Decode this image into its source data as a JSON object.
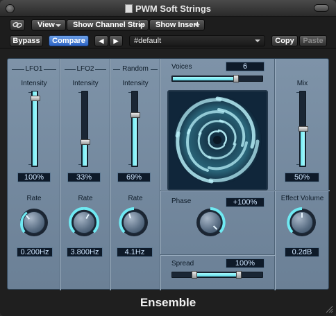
{
  "window": {
    "title": "PWM Soft Strings"
  },
  "toolbar": {
    "view_label": "View",
    "channel_strip_label": "Show Channel Strip",
    "insert_label": "Show Insert",
    "bypass_label": "Bypass",
    "compare_label": "Compare",
    "prev_label": "◀",
    "next_label": "▶",
    "preset_value": "#default",
    "copy_label": "Copy",
    "paste_label": "Paste"
  },
  "lfo1": {
    "header": "LFO1",
    "intensity_label": "Intensity",
    "intensity_value": "100%",
    "intensity_level": 1.0,
    "rate_label": "Rate",
    "rate_value": "0.200Hz"
  },
  "lfo2": {
    "header": "LFO2",
    "intensity_label": "Intensity",
    "intensity_value": "33%",
    "intensity_level": 0.33,
    "rate_label": "Rate",
    "rate_value": "3.800Hz"
  },
  "random": {
    "header": "Random",
    "intensity_label": "Intensity",
    "intensity_value": "69%",
    "intensity_level": 0.69,
    "rate_label": "Rate",
    "rate_value": "4.1Hz"
  },
  "voices": {
    "label": "Voices",
    "value": "6"
  },
  "phase": {
    "label": "Phase",
    "value": "+100%"
  },
  "spread": {
    "label": "Spread",
    "value": "100%"
  },
  "mix": {
    "label": "Mix",
    "value": "50%",
    "level": 0.5
  },
  "effect_volume": {
    "label": "Effect Volume",
    "value": "0.2dB"
  },
  "footer": {
    "plugin_name": "Ensemble"
  },
  "colors": {
    "accent": "#6fe9f2",
    "panel": "#7488a0",
    "compare": "#3f7ad6"
  }
}
